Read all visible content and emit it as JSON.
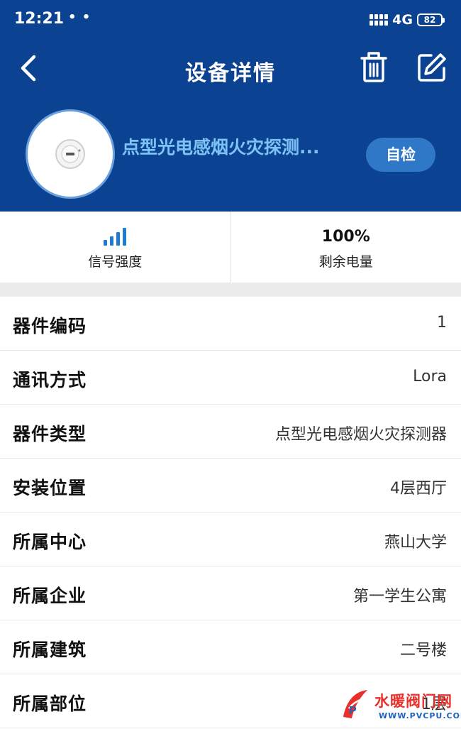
{
  "status_bar": {
    "time": "12:21",
    "dots": "• •",
    "network": "4G",
    "battery": "82"
  },
  "nav": {
    "title": "设备详情",
    "back_icon": "chevron-left-icon",
    "delete_icon": "trash-icon",
    "edit_icon": "edit-icon"
  },
  "device": {
    "name": "点型光电感烟火灾探测...",
    "self_check_label": "自检",
    "image_icon": "smoke-detector-icon"
  },
  "stats": [
    {
      "label": "信号强度",
      "icon": "signal-bars-icon",
      "signal_bars": 4
    },
    {
      "label": "剩余电量",
      "value": "100%"
    }
  ],
  "details": [
    {
      "label": "器件编码",
      "value": "1"
    },
    {
      "label": "通讯方式",
      "value": "Lora"
    },
    {
      "label": "器件类型",
      "value": "点型光电感烟火灾探测器"
    },
    {
      "label": "安装位置",
      "value": "4层西厅"
    },
    {
      "label": "所属中心",
      "value": "燕山大学"
    },
    {
      "label": "所属企业",
      "value": "第一学生公寓"
    },
    {
      "label": "所属建筑",
      "value": "二号楼"
    },
    {
      "label": "所属部位",
      "value": "1层"
    }
  ],
  "watermark": {
    "text": "水暖阀门网",
    "url": "WWW.PVCPU.COM"
  },
  "colors": {
    "header_bg": "#0b4292",
    "device_name": "#7ec3f5",
    "button_bg": "#2f78c7",
    "signal": "#1f7bd1"
  }
}
